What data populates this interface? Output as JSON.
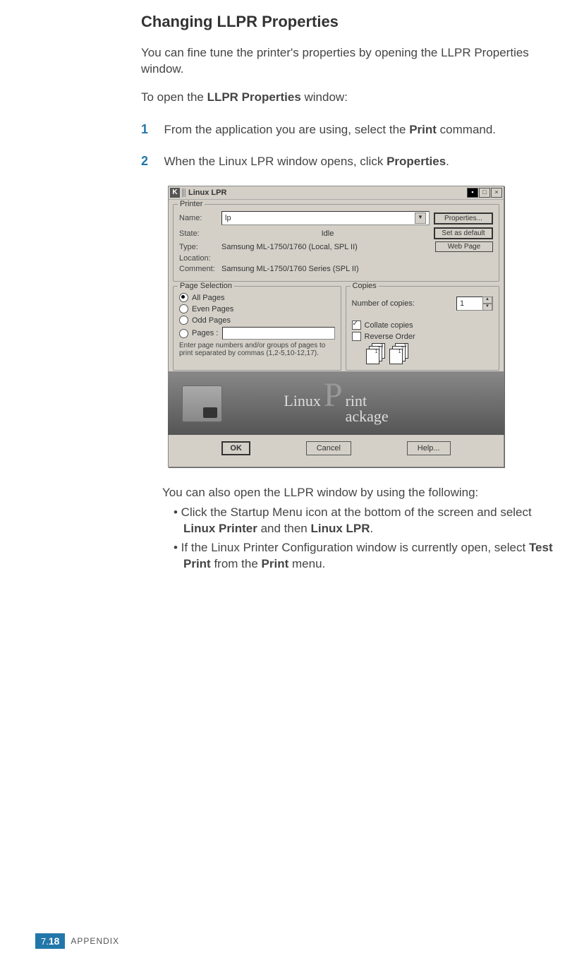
{
  "heading": "Changing LLPR Properties",
  "intro1_a": "You can fine tune the printer's properties by opening the LLPR Properties window.",
  "intro2_a": "To open the ",
  "intro2_b": "LLPR Properties",
  "intro2_c": " window:",
  "step1_num": "1",
  "step1_a": "From the application you are using, select the ",
  "step1_b": "Print",
  "step1_c": " command.",
  "step2_num": "2",
  "step2_a": "When the Linux LPR window opens, click ",
  "step2_b": "Properties",
  "step2_c": ".",
  "window": {
    "title_k": "K",
    "title": "Linux LPR",
    "printer_group": "Printer",
    "name_lbl": "Name:",
    "name_val": "lp",
    "state_lbl": "State:",
    "state_val": "Idle",
    "type_lbl": "Type:",
    "type_val": "Samsung ML-1750/1760 (Local, SPL II)",
    "location_lbl": "Location:",
    "comment_lbl": "Comment:",
    "comment_val": "Samsung ML-1750/1760 Series (SPL II)",
    "btn_props": "Properties...",
    "btn_default": "Set as default",
    "btn_web": "Web Page",
    "pagesel_group": "Page Selection",
    "r_all": "All Pages",
    "r_even": "Even Pages",
    "r_odd": "Odd Pages",
    "r_pages": "Pages :",
    "pages_hint": "Enter page numbers and/or groups of pages to print separated by commas (1,2-5,10-12,17).",
    "copies_group": "Copies",
    "num_copies_lbl": "Number of copies:",
    "num_copies_val": "1",
    "collate": "Collate copies",
    "reverse": "Reverse Order",
    "banner_linux": "Linux",
    "banner_rint": "rint",
    "banner_ackage": "ackage",
    "ok": "OK",
    "cancel": "Cancel",
    "help": "Help..."
  },
  "after1": "You can also open the LLPR window by using the following:",
  "bul1_a": "• Click the Startup Menu icon at the bottom of the screen and select ",
  "bul1_b": "Linux Printer",
  "bul1_c": " and then ",
  "bul1_d": "Linux LPR",
  "bul1_e": ".",
  "bul2_a": "• If the Linux Printer Configuration window is currently open, select ",
  "bul2_b": "Test Print",
  "bul2_c": " from the ",
  "bul2_d": "Print",
  "bul2_e": " menu.",
  "footer_ch": "7.",
  "footer_pg": "18",
  "footer_label": "APPENDIX"
}
